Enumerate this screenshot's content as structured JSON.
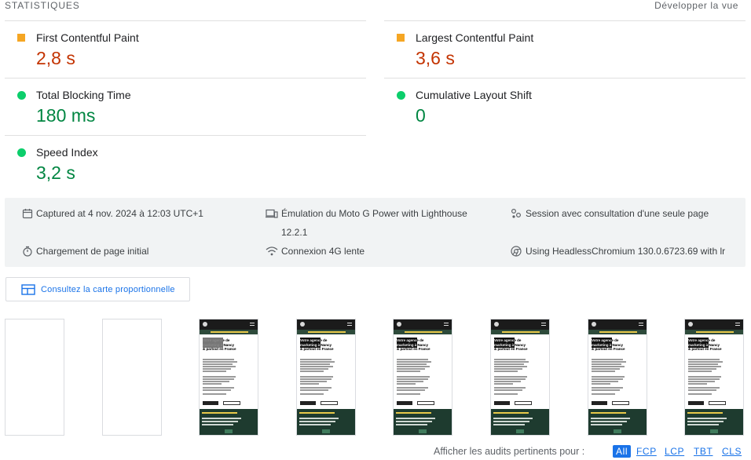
{
  "header": {
    "title": "STATISTIQUES",
    "expand_label": "Développer la vue"
  },
  "metrics": [
    {
      "name": "First Contentful Paint",
      "value": "2,8 s",
      "status": "average",
      "indicator": "orange-square"
    },
    {
      "name": "Largest Contentful Paint",
      "value": "3,6 s",
      "status": "average",
      "indicator": "orange-square"
    },
    {
      "name": "Total Blocking Time",
      "value": "180 ms",
      "status": "pass",
      "indicator": "green-circle"
    },
    {
      "name": "Cumulative Layout Shift",
      "value": "0",
      "status": "pass",
      "indicator": "green-circle"
    },
    {
      "name": "Speed Index",
      "value": "3,2 s",
      "status": "pass",
      "indicator": "green-circle"
    }
  ],
  "runtime_info": {
    "captured": "Captured at 4 nov. 2024 à 12:03 UTC+1",
    "emulation": "Émulation du Moto G Power with Lighthouse",
    "emulation_version": "12.2.1",
    "session": "Session avec consultation d'une seule page",
    "page_load": "Chargement de page initial",
    "connection": "Connexion 4G lente",
    "browser": "Using HeadlessChromium 130.0.6723.69 with lr"
  },
  "treemap_button": {
    "label": "Consultez la carte proportionnelle"
  },
  "filmstrip": {
    "frame_count": 8,
    "page": {
      "headline": "Votre agence de marketing à Nancy & partout en France",
      "cta_section": "Des gardes de présentation à 360°"
    }
  },
  "audit_filter": {
    "label": "Afficher les audits pertinents pour :",
    "options": [
      "All",
      "FCP",
      "LCP",
      "TBT",
      "CLS"
    ],
    "selected": "All"
  },
  "colors": {
    "average": "#c33300",
    "pass": "#018642",
    "orange_indicator": "#f5a623",
    "green_indicator": "#0cce6b",
    "accent": "#1a73e8"
  }
}
